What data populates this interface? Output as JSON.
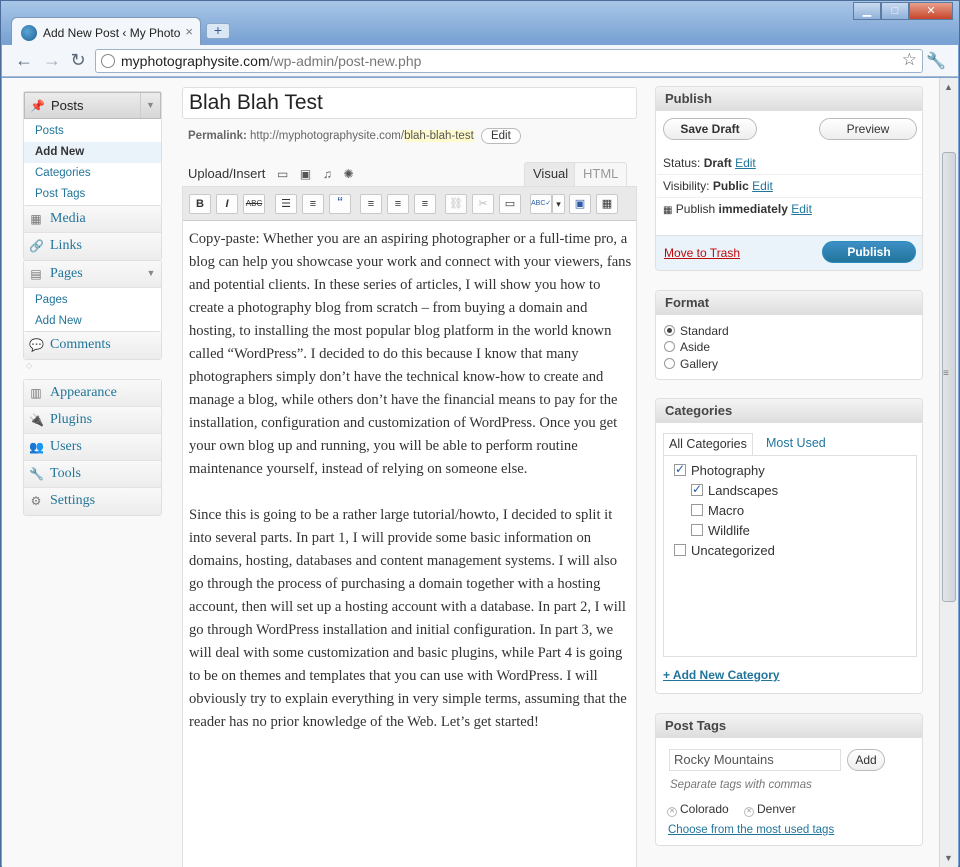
{
  "browser": {
    "tab_title": "Add New Post ‹ My Photo...",
    "tab_close": "×",
    "new_tab": "+",
    "url_host": "myphotographysite.com",
    "url_path": "/wp-admin/post-new.php",
    "back": "←",
    "forward": "→",
    "reload": "↻",
    "bookmark": "☆",
    "wrench": "🔧",
    "win_min": "▁",
    "win_max": "□",
    "win_close": "✕"
  },
  "menu": {
    "posts": {
      "label": "Posts",
      "items": [
        "Posts",
        "Add New",
        "Categories",
        "Post Tags"
      ]
    },
    "media": "Media",
    "links": "Links",
    "pages": {
      "label": "Pages",
      "items": [
        "Pages",
        "Add New"
      ]
    },
    "comments": "Comments",
    "appearance": "Appearance",
    "plugins": "Plugins",
    "users": "Users",
    "tools": "Tools",
    "settings": "Settings"
  },
  "post": {
    "title": "Blah Blah Test",
    "permalink_label": "Permalink:",
    "permalink_base": "http://myphotographysite.com/",
    "permalink_slug": "blah-blah-test",
    "permalink_edit": "Edit",
    "upload_insert": "Upload/Insert",
    "tab_visual": "Visual",
    "tab_html": "HTML",
    "body_p1": "Copy-paste: Whether you are an aspiring photographer or a full-time pro, a blog can help you showcase your work and connect with your viewers, fans and potential clients. In these series of articles, I will show you how to create a photography blog from scratch – from buying a domain and hosting, to installing the most popular blog platform in the world known called “WordPress”. I decided to do this because I know that many photographers simply don’t have the technical know-how to create and manage a blog, while others don’t have the financial means to pay for the installation, configuration and customization of WordPress. Once you get your own blog up and running, you will be able to perform routine maintenance yourself, instead of relying on someone else.",
    "body_p2": "Since this is going to be a rather large tutorial/howto, I decided to split it into several parts. In part 1, I will provide some basic information on domains, hosting, databases and content management systems. I will also go through the process of purchasing a domain together with a hosting account, then will set up a hosting account with a database. In part 2, I will go through WordPress installation and initial configuration. In part 3, we will deal with some customization and basic plugins, while Part 4 is going to be on themes and templates that you can use with WordPress. I will obviously try to explain everything in very simple terms, assuming that the reader has no prior knowledge of the Web. Let’s get started!"
  },
  "toolbar": {
    "bold": "B",
    "italic": "I",
    "strike": "ABC",
    "ul": "☰",
    "ol": "≡",
    "quote": "“",
    "align_left": "≡",
    "align_center": "≡",
    "align_right": "≡",
    "link": "⛓",
    "unlink": "✂",
    "more": "▭",
    "spell": "ABC✓",
    "spell_arrow": "▾",
    "fullscreen": "▣",
    "kitchen": "▦"
  },
  "publish": {
    "header": "Publish",
    "save_draft": "Save Draft",
    "preview": "Preview",
    "status_label": "Status:",
    "status_value": "Draft",
    "visibility_label": "Visibility:",
    "visibility_value": "Public",
    "publish_label": "Publish",
    "publish_value": "immediately",
    "edit": "Edit",
    "trash": "Move to Trash",
    "publish_button": "Publish"
  },
  "format": {
    "header": "Format",
    "options": [
      "Standard",
      "Aside",
      "Gallery"
    ],
    "selected": "Standard"
  },
  "categories": {
    "header": "Categories",
    "tab_all": "All Categories",
    "tab_most": "Most Used",
    "items": [
      {
        "label": "Photography",
        "checked": true,
        "level": 0
      },
      {
        "label": "Landscapes",
        "checked": true,
        "level": 1
      },
      {
        "label": "Macro",
        "checked": false,
        "level": 1
      },
      {
        "label": "Wildlife",
        "checked": false,
        "level": 1
      },
      {
        "label": "Uncategorized",
        "checked": false,
        "level": 0
      }
    ],
    "add_new": "+ Add New Category"
  },
  "tags": {
    "header": "Post Tags",
    "input_value": "Rocky Mountains",
    "add": "Add",
    "hint": "Separate tags with commas",
    "list": [
      "Colorado",
      "Denver"
    ],
    "choose": "Choose from the most used tags"
  },
  "colors": {
    "link": "#21759b",
    "primary": "#21759b",
    "trash": "#bc0b0b",
    "slug_highlight": "#fffbcc"
  }
}
